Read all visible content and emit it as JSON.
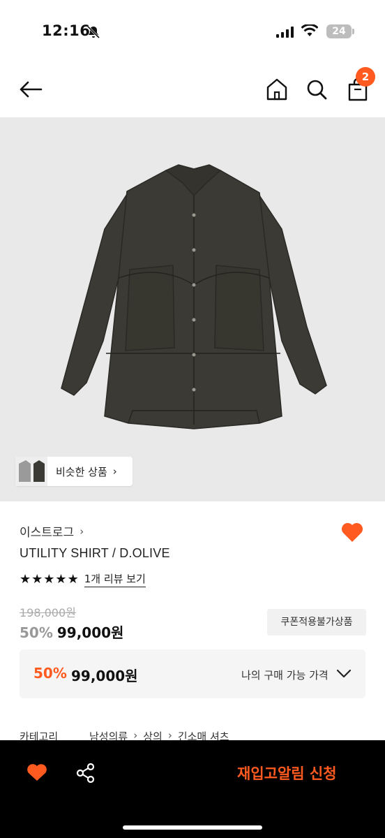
{
  "status_bar": {
    "time": "12:16",
    "battery": "24"
  },
  "header": {
    "cart_count": "2"
  },
  "product": {
    "similar_label": "비슷한 상품",
    "brand": "이스트로그",
    "name": "UTILITY SHIRT / D.OLIVE",
    "rating_stars": 5,
    "review_link": "1개 리뷰 보기",
    "original_price": "198,000원",
    "discount": "50%",
    "price": "99,000원",
    "coupon_tag": "쿠폰적용불가상품",
    "my_price": {
      "discount": "50%",
      "price": "99,000원",
      "label": "나의 구매 가능 가격"
    },
    "category": {
      "label": "카테고리",
      "path": [
        "남성의류",
        "상의",
        "긴소매 셔츠"
      ]
    }
  },
  "bottom_bar": {
    "restock_label": "재입고알림 신청"
  },
  "colors": {
    "accent": "#ff5a1f",
    "image_bg": "#e9e9e9",
    "shirt": "#3b3a35"
  },
  "icons": [
    "bell-off-icon",
    "signal-icon",
    "wifi-icon",
    "battery-icon",
    "back-arrow-icon",
    "home-icon",
    "search-icon",
    "cart-icon",
    "chevron-right-icon",
    "heart-icon",
    "star-icon",
    "chevron-down-icon",
    "share-icon"
  ]
}
